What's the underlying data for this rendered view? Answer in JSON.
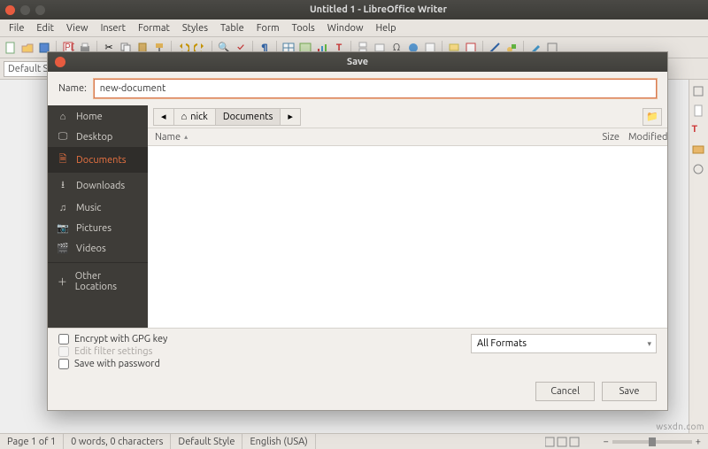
{
  "window": {
    "title": "Untitled 1 - LibreOffice Writer"
  },
  "menubar": [
    "File",
    "Edit",
    "View",
    "Insert",
    "Format",
    "Styles",
    "Table",
    "Form",
    "Tools",
    "Window",
    "Help"
  ],
  "formatbar": {
    "style_combo": "Default S"
  },
  "statusbar": {
    "page": "Page 1 of 1",
    "words": "0 words, 0 characters",
    "style": "Default Style",
    "lang": "English (USA)"
  },
  "watermark": "wsxdn.com",
  "dialog": {
    "title": "Save",
    "name_label": "Name:",
    "name_value": "new-document",
    "places": [
      {
        "icon": "home-icon",
        "label": "Home"
      },
      {
        "icon": "desktop-icon",
        "label": "Desktop"
      },
      {
        "icon": "documents-icon",
        "label": "Documents",
        "selected": true
      },
      {
        "icon": "downloads-icon",
        "label": "Downloads"
      },
      {
        "icon": "music-icon",
        "label": "Music"
      },
      {
        "icon": "pictures-icon",
        "label": "Pictures"
      },
      {
        "icon": "videos-icon",
        "label": "Videos"
      }
    ],
    "other_locations": "Other Locations",
    "path": {
      "back": "◂",
      "items": [
        {
          "icon": "home-icon",
          "label": "nick"
        },
        {
          "label": "Documents",
          "active": true
        }
      ],
      "forward": "▸"
    },
    "columns": {
      "name": "Name",
      "sort": "▴",
      "size": "Size",
      "modified": "Modified"
    },
    "encrypt": "Encrypt with GPG key",
    "filter": "Edit filter settings",
    "password": "Save with password",
    "format": "All Formats",
    "cancel": "Cancel",
    "save": "Save"
  }
}
